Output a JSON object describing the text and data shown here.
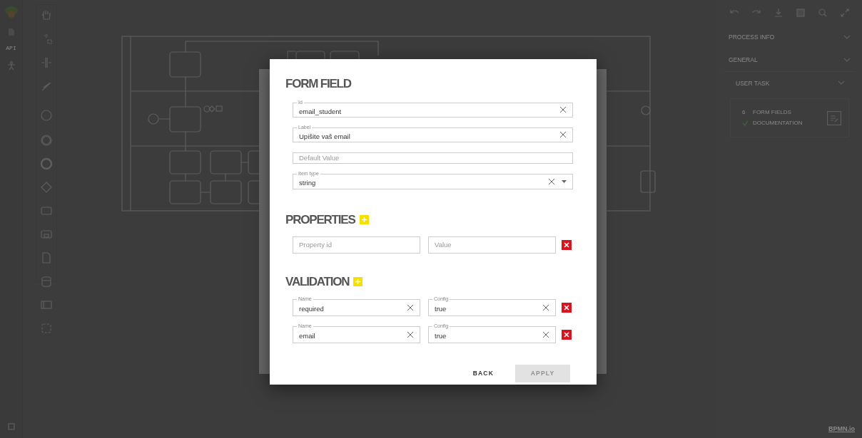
{
  "left_rail": {
    "api_label": "API"
  },
  "right_panel": {
    "sections": [
      {
        "title": "PROCESS INFO"
      },
      {
        "title": "GENERAL"
      },
      {
        "title": "USER TASK"
      }
    ],
    "summary": [
      {
        "kind": "count",
        "count": "6",
        "label": "FORM FIELDS"
      },
      {
        "kind": "check",
        "label": "DOCUMENTATION"
      }
    ],
    "brand": "BPMN.io"
  },
  "modal": {
    "form_field": {
      "title": "FORM FIELD",
      "fields": [
        {
          "kind": "text",
          "label": "Id",
          "value": "email_student"
        },
        {
          "kind": "text",
          "label": "Label",
          "value": "Upišite vaš email"
        },
        {
          "kind": "text",
          "placeholder": "Default Value"
        },
        {
          "kind": "select",
          "label": "Item type",
          "value": "string"
        }
      ]
    },
    "properties": {
      "title": "PROPERTIES",
      "rows": [
        {
          "fields": [
            {
              "placeholder": "Property id"
            },
            {
              "placeholder": "Value"
            }
          ]
        }
      ]
    },
    "validation": {
      "title": "VALIDATION",
      "rows": [
        {
          "fields": [
            {
              "label": "Name",
              "value": "required"
            },
            {
              "label": "Config",
              "value": "true"
            }
          ]
        },
        {
          "fields": [
            {
              "label": "Name",
              "value": "email"
            },
            {
              "label": "Config",
              "value": "true"
            }
          ]
        }
      ]
    },
    "buttons": [
      {
        "label": "BACK",
        "disabled": false
      },
      {
        "label": "APPLY",
        "disabled": true
      }
    ]
  }
}
